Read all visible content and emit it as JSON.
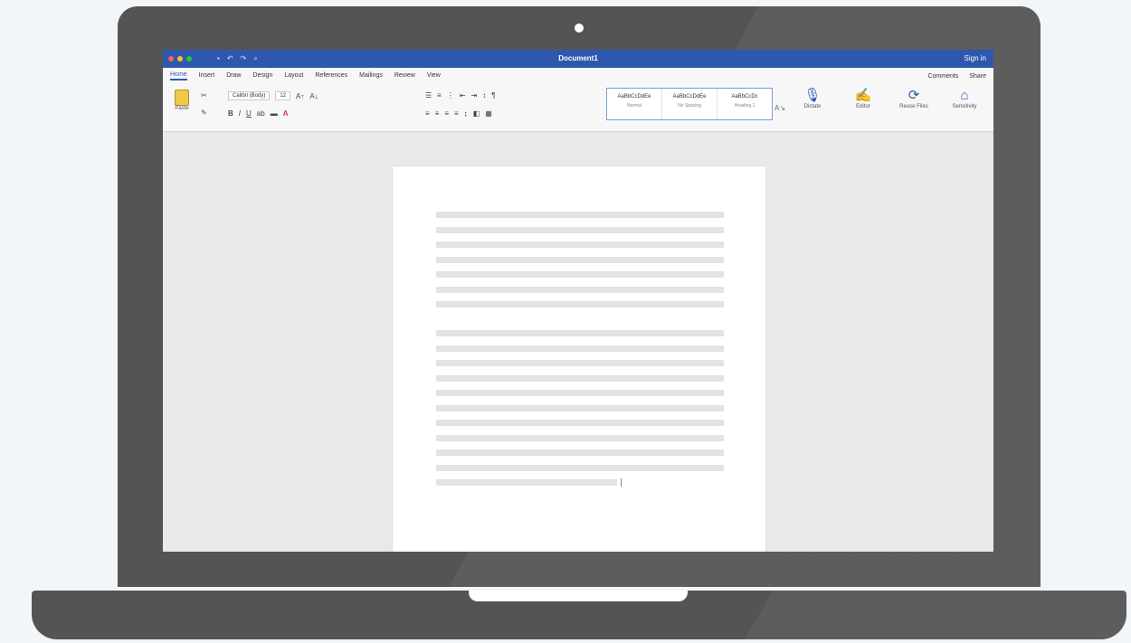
{
  "colors": {
    "brand_blue": "#2e58ae",
    "device_gray": "#545454",
    "background": "#f3f6f8",
    "page_white": "#ffffff",
    "text_placeholder": "#e3e3e3"
  },
  "titlebar": {
    "title": "Document1",
    "right": "Sign in"
  },
  "ribbon": {
    "tabs": [
      {
        "label": "Home",
        "active": true
      },
      {
        "label": "Insert"
      },
      {
        "label": "Draw"
      },
      {
        "label": "Design"
      },
      {
        "label": "Layout"
      },
      {
        "label": "References"
      },
      {
        "label": "Mailings"
      },
      {
        "label": "Review"
      },
      {
        "label": "View"
      }
    ],
    "tabs_right": {
      "share": "Share",
      "comments": "Comments"
    },
    "clipboard": {
      "paste_label": "Paste"
    },
    "font": {
      "name": "Calibri (Body)",
      "size": "12"
    },
    "styles": [
      {
        "name": "AaBbCcDdEe",
        "label": "Normal"
      },
      {
        "name": "AaBbCcDdEe",
        "label": "No Spacing"
      },
      {
        "name": "AaBbCcDc",
        "label": "Heading 1"
      }
    ],
    "tools": [
      {
        "icon": "microphone-icon",
        "label": "Dictate"
      },
      {
        "icon": "editor-icon",
        "label": "Editor"
      },
      {
        "icon": "reuse-files-icon",
        "label": "Reuse Files"
      },
      {
        "icon": "sensitivity-icon",
        "label": "Sensitivity"
      }
    ]
  },
  "document": {
    "paragraph1_lines": 7,
    "paragraph2_lines": 11
  }
}
